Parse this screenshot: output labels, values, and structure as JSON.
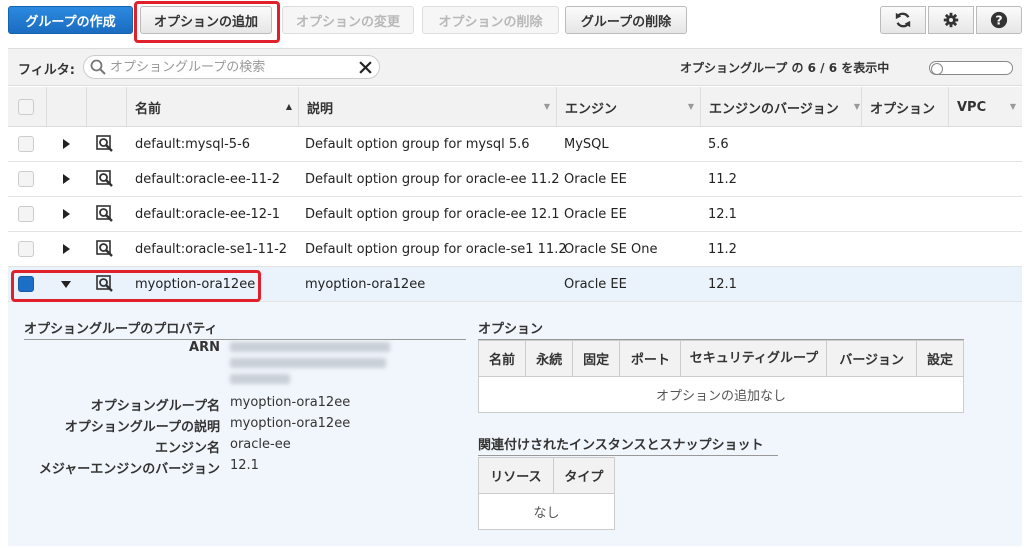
{
  "toolbar": {
    "create_group": "グループの作成",
    "add_option": "オプションの追加",
    "modify_option": "オプションの変更",
    "delete_option": "オプションの削除",
    "delete_group": "グループの削除",
    "refresh_icon": "refresh-icon",
    "settings_icon": "gear-icon",
    "help_icon": "help-icon"
  },
  "filter": {
    "label": "フィルタ:",
    "placeholder": "オプショングループの検索",
    "count_text": "オプショングループ の 6 / 6 を表示中"
  },
  "columns": {
    "name": "名前",
    "description": "説明",
    "engine": "エンジン",
    "engine_version": "エンジンのバージョン",
    "options": "オプション",
    "vpc": "VPC"
  },
  "rows": [
    {
      "name": "default:mysql-5-6",
      "description": "Default option group for mysql 5.6",
      "engine": "MySQL",
      "version": "5.6"
    },
    {
      "name": "default:oracle-ee-11-2",
      "description": "Default option group for oracle-ee 11.2",
      "engine": "Oracle EE",
      "version": "11.2"
    },
    {
      "name": "default:oracle-ee-12-1",
      "description": "Default option group for oracle-ee 12.1",
      "engine": "Oracle EE",
      "version": "12.1"
    },
    {
      "name": "default:oracle-se1-11-2",
      "description": "Default option group for oracle-se1 11.2",
      "engine": "Oracle SE One",
      "version": "11.2"
    },
    {
      "name": "myoption-ora12ee",
      "description": "myoption-ora12ee",
      "engine": "Oracle EE",
      "version": "12.1"
    }
  ],
  "details": {
    "properties_title": "オプショングループのプロパティ",
    "arn_label": "ARN",
    "group_name_label": "オプショングループ名",
    "group_name_value": "myoption-ora12ee",
    "group_desc_label": "オプショングループの説明",
    "group_desc_value": "myoption-ora12ee",
    "engine_label": "エンジン名",
    "engine_value": "oracle-ee",
    "major_version_label": "メジャーエンジンのバージョン",
    "major_version_value": "12.1",
    "options_title": "オプション",
    "options_columns": [
      "名前",
      "永続",
      "固定",
      "ポート",
      "セキュリティグループ",
      "バージョン",
      "設定"
    ],
    "options_empty": "オプションの追加なし",
    "assoc_title": "関連付けされたインスタンスとスナップショット",
    "assoc_columns": [
      "リソース",
      "タイプ"
    ],
    "assoc_empty": "なし"
  },
  "colors": {
    "primary": "#1a6cc0",
    "highlight": "#e0202a",
    "selected_row": "#eaf3fc"
  }
}
